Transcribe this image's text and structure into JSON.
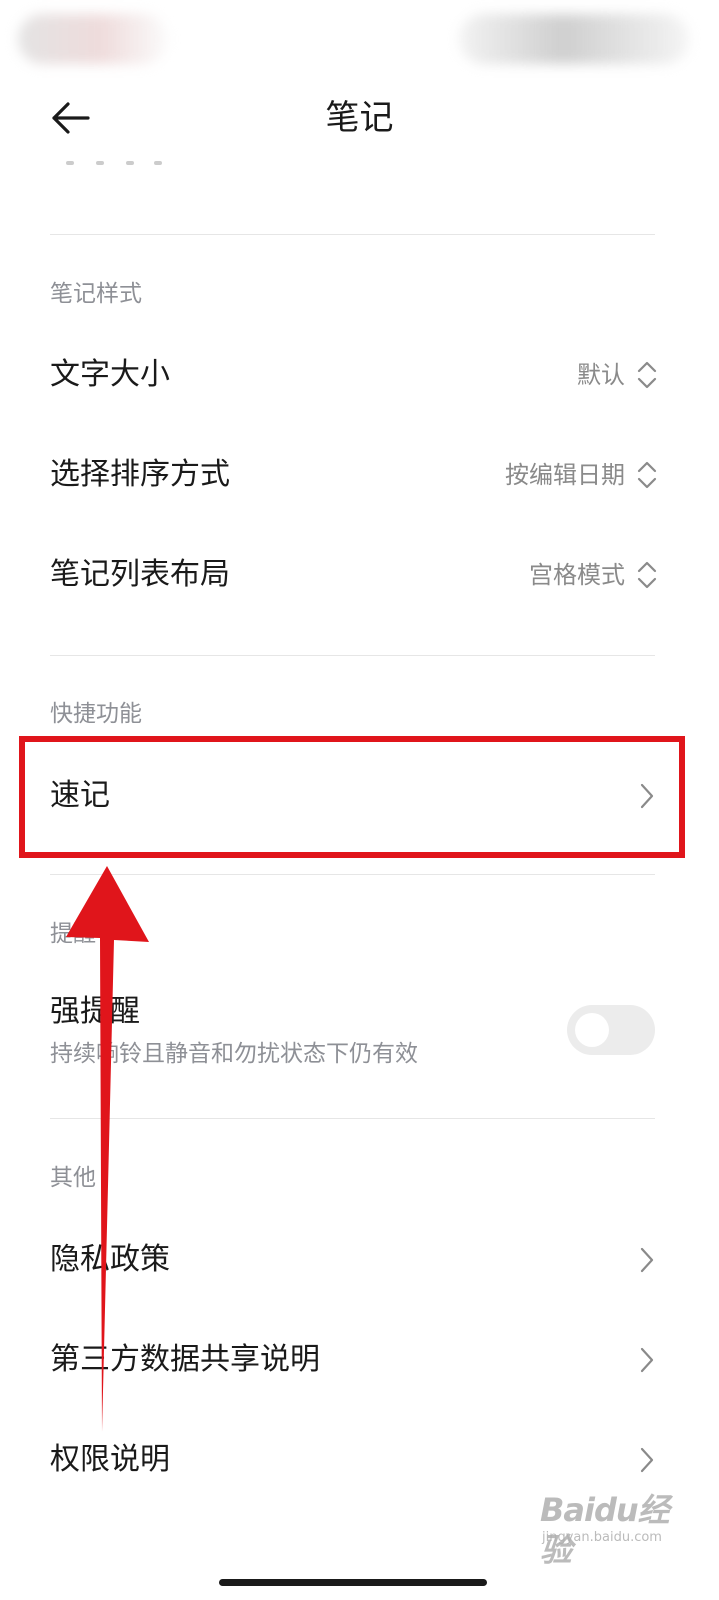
{
  "header": {
    "title": "笔记",
    "back_icon": "arrow-left-icon"
  },
  "sections": {
    "style": {
      "label": "笔记样式",
      "items": [
        {
          "label": "文字大小",
          "value": "默认"
        },
        {
          "label": "选择排序方式",
          "value": "按编辑日期"
        },
        {
          "label": "笔记列表布局",
          "value": "宫格模式"
        }
      ]
    },
    "shortcuts": {
      "label": "快捷功能",
      "items": [
        {
          "label": "速记"
        }
      ]
    },
    "reminder": {
      "label": "提醒",
      "items": [
        {
          "label": "强提醒",
          "description": "持续响铃且静音和勿扰状态下仍有效",
          "toggle_on": false
        }
      ]
    },
    "other": {
      "label": "其他",
      "items": [
        {
          "label": "隐私政策"
        },
        {
          "label": "第三方数据共享说明"
        },
        {
          "label": "权限说明"
        }
      ]
    }
  },
  "annotation": {
    "highlight_color": "#e0151b"
  },
  "watermark": {
    "logo": "Baidu经验",
    "url": "jingyan.baidu.com"
  }
}
